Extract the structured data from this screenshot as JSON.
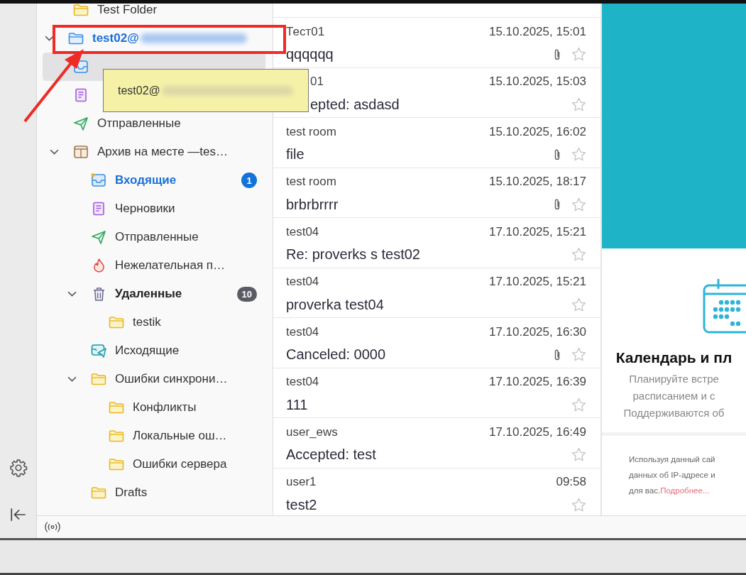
{
  "folders": [
    {
      "children": [
        {
          "label": "Test Folder",
          "kind": "folder",
          "selected": false
        }
      ]
    },
    {
      "label": "test02@",
      "kind": "account",
      "expanded": true,
      "selected": false,
      "children": [
        {
          "kind": "inbox",
          "selected": true
        },
        {
          "kind": "drafts",
          "selected": false
        },
        {
          "label": "Отправленные",
          "kind": "sent",
          "selected": false
        },
        {
          "label": "Архив на месте —tes…",
          "kind": "archive",
          "expanded": true,
          "selected": false,
          "children": [
            {
              "label": "Входящие",
              "kind": "inbox",
              "selected": false,
              "unread": true,
              "new": true,
              "badge": "1"
            },
            {
              "label": "Черновики",
              "kind": "drafts",
              "selected": false
            },
            {
              "label": "Отправленные",
              "kind": "sent",
              "selected": false
            },
            {
              "label": "Нежелательная п…",
              "kind": "junk",
              "selected": false
            },
            {
              "label": "Удаленные",
              "kind": "trash",
              "expanded": true,
              "selected": false,
              "unread": true,
              "badge": "10",
              "children": [
                {
                  "label": "testik",
                  "kind": "folder",
                  "selected": false
                }
              ]
            },
            {
              "label": "Исходящие",
              "kind": "outbox",
              "selected": false
            },
            {
              "label": "Ошибки синхрони…",
              "kind": "folder",
              "expanded": true,
              "selected": false,
              "children": [
                {
                  "label": "Конфликты",
                  "kind": "folder",
                  "selected": false
                },
                {
                  "label": "Локальные ош…",
                  "kind": "folder",
                  "selected": false
                },
                {
                  "label": "Ошибки сервера",
                  "kind": "folder",
                  "selected": false
                }
              ]
            },
            {
              "label": "Drafts",
              "kind": "folder",
              "selected": false
            }
          ]
        }
      ]
    }
  ],
  "tooltip": {
    "text": "test02@"
  },
  "messages": [
    {
      "sender": "Тест01",
      "date": "15.10.2025, 15:01",
      "subject": "qqqqqq",
      "attachment": true,
      "starred": false
    },
    {
      "sender": "01",
      "date": "15.10.2025, 15:03",
      "subject": "epted: asdasd",
      "attachment": false,
      "starred": false
    },
    {
      "sender": "test room",
      "date": "15.10.2025, 16:02",
      "subject": "file",
      "attachment": true,
      "starred": false
    },
    {
      "sender": "test room",
      "date": "15.10.2025, 18:17",
      "subject": "brbrbrrrr",
      "attachment": true,
      "starred": false
    },
    {
      "sender": "test04",
      "date": "17.10.2025, 15:21",
      "subject": "Re: proverks s test02",
      "attachment": false,
      "starred": false
    },
    {
      "sender": "test04",
      "date": "17.10.2025, 15:21",
      "subject": "proverka test04",
      "attachment": false,
      "starred": false
    },
    {
      "sender": "test04",
      "date": "17.10.2025, 16:30",
      "subject": "Canceled: 0000",
      "attachment": true,
      "starred": false
    },
    {
      "sender": "test04",
      "date": "17.10.2025, 16:39",
      "subject": "111",
      "attachment": false,
      "starred": false
    },
    {
      "sender": "user_ews",
      "date": "17.10.2025, 16:49",
      "subject": "Accepted: test",
      "attachment": false,
      "starred": false
    },
    {
      "sender": "user1",
      "date": "09:58",
      "subject": "test2",
      "attachment": false,
      "starred": false
    }
  ],
  "promo": {
    "heading": "Календарь и пл",
    "lines": [
      "Планируйте встре",
      "расписанием и с",
      "Поддерживаются об"
    ]
  },
  "cookie_notice": {
    "lines": [
      "Используя данный сай",
      "данных об IP-адресе и",
      "для вас."
    ],
    "link": "Подробнее..."
  }
}
